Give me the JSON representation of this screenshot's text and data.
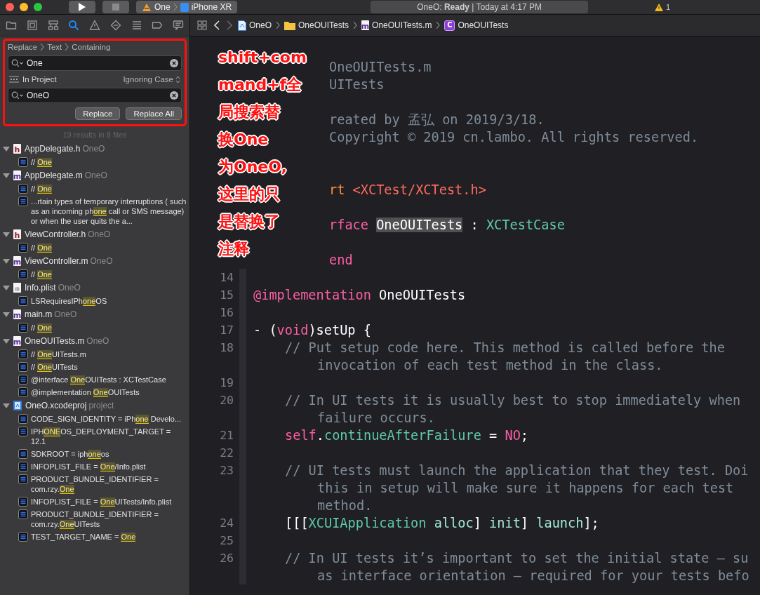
{
  "toolbar": {
    "target": "One",
    "device": "iPhone XR",
    "activity": "OneO: **Ready** | Today at 4:17 PM",
    "warning_count": "1"
  },
  "navigator_tabs": [
    {
      "kind": "folder",
      "selected": false
    },
    {
      "kind": "source-control",
      "selected": false
    },
    {
      "kind": "hierarchy",
      "selected": false
    },
    {
      "kind": "search",
      "selected": true
    },
    {
      "kind": "warning",
      "selected": false
    },
    {
      "kind": "diamond",
      "selected": false
    },
    {
      "kind": "list",
      "selected": false
    },
    {
      "kind": "tag",
      "selected": false
    },
    {
      "kind": "message",
      "selected": false
    }
  ],
  "jump_bar": [
    {
      "kind": "project",
      "label": "OneO"
    },
    {
      "kind": "folder",
      "label": "OneOUITests"
    },
    {
      "kind": "file",
      "badge": "m",
      "label": "OneOUITests.m"
    },
    {
      "kind": "class",
      "badge": "C",
      "label": "OneOUITests"
    }
  ],
  "find": {
    "path": [
      "Replace",
      "Text",
      "Containing"
    ],
    "query": "One",
    "scope": "In Project",
    "matching": "Ignoring Case",
    "replacement": "OneO",
    "buttons": [
      "Replace",
      "Replace All"
    ],
    "summary": "19 results in 8 files"
  },
  "results": [
    {
      "file": "AppDelegate.h",
      "project": "OneO",
      "kind": "source",
      "badge": "h",
      "expanded": true,
      "children": [
        {
          "parts": [
            {
              "text": "//  ",
              "match": false
            },
            {
              "text": "One",
              "match": true
            }
          ]
        }
      ]
    },
    {
      "file": "AppDelegate.m",
      "project": "OneO",
      "kind": "source",
      "badge": "m",
      "expanded": true,
      "children": [
        {
          "parts": [
            {
              "text": "//  ",
              "match": false
            },
            {
              "text": "One",
              "match": true
            }
          ]
        },
        {
          "parts": [
            {
              "text": "...rtain types of temporary interruptions ( such as an incoming ph",
              "match": false
            },
            {
              "text": "one",
              "match": true
            },
            {
              "text": " call or SMS message) or when the user quits the a...",
              "match": false
            }
          ]
        }
      ]
    },
    {
      "file": "ViewController.h",
      "project": "OneO",
      "kind": "source",
      "badge": "h",
      "expanded": true,
      "children": [
        {
          "parts": [
            {
              "text": "//  ",
              "match": false
            },
            {
              "text": "One",
              "match": true
            }
          ]
        }
      ]
    },
    {
      "file": "ViewController.m",
      "project": "OneO",
      "kind": "source",
      "badge": "m",
      "expanded": true,
      "children": [
        {
          "parts": [
            {
              "text": "//  ",
              "match": false
            },
            {
              "text": "One",
              "match": true
            }
          ]
        }
      ]
    },
    {
      "file": "Info.plist",
      "project": "OneO",
      "kind": "plist",
      "expanded": true,
      "children": [
        {
          "parts": [
            {
              "text": "LSRequiresIPh",
              "match": false
            },
            {
              "text": "one",
              "match": true
            },
            {
              "text": "OS",
              "match": false
            }
          ]
        }
      ]
    },
    {
      "file": "main.m",
      "project": "OneO",
      "kind": "source",
      "badge": "m",
      "expanded": true,
      "children": [
        {
          "parts": [
            {
              "text": "//  ",
              "match": false
            },
            {
              "text": "One",
              "match": true
            }
          ]
        }
      ]
    },
    {
      "file": "OneOUITests.m",
      "project": "OneO",
      "kind": "source",
      "badge": "m",
      "expanded": true,
      "children": [
        {
          "parts": [
            {
              "text": "//  ",
              "match": false
            },
            {
              "text": "One",
              "match": true
            },
            {
              "text": "UITests.m",
              "match": false
            }
          ]
        },
        {
          "parts": [
            {
              "text": "//  ",
              "match": false
            },
            {
              "text": "One",
              "match": true
            },
            {
              "text": "UITests",
              "match": false
            }
          ]
        },
        {
          "parts": [
            {
              "text": "@interface ",
              "match": false
            },
            {
              "text": "One",
              "match": true
            },
            {
              "text": "OUITests : XCTestCase",
              "match": false
            }
          ]
        },
        {
          "parts": [
            {
              "text": "@implementation ",
              "match": false
            },
            {
              "text": "One",
              "match": true
            },
            {
              "text": "OUITests",
              "match": false
            }
          ]
        }
      ]
    },
    {
      "file": "OneO.xcodeproj",
      "project": "project",
      "kind": "project",
      "expanded": true,
      "children": [
        {
          "parts": [
            {
              "text": "CODE_SIGN_IDENTITY = iPh",
              "match": false
            },
            {
              "text": "one",
              "match": true
            },
            {
              "text": " Develo...",
              "match": false
            }
          ]
        },
        {
          "parts": [
            {
              "text": "IPH",
              "match": false
            },
            {
              "text": "ONE",
              "match": true
            },
            {
              "text": "OS_DEPLOYMENT_TARGET = 12.1",
              "match": false
            }
          ]
        },
        {
          "parts": [
            {
              "text": "SDKROOT = iph",
              "match": false
            },
            {
              "text": "one",
              "match": true
            },
            {
              "text": "os",
              "match": false
            }
          ]
        },
        {
          "parts": [
            {
              "text": "INFOPLIST_FILE = ",
              "match": false
            },
            {
              "text": "One",
              "match": true
            },
            {
              "text": "/Info.plist",
              "match": false
            }
          ]
        },
        {
          "parts": [
            {
              "text": "PRODUCT_BUNDLE_IDENTIFIER = com.rzy.",
              "match": false
            },
            {
              "text": "One",
              "match": true
            }
          ]
        },
        {
          "parts": [
            {
              "text": "INFOPLIST_FILE = ",
              "match": false
            },
            {
              "text": "One",
              "match": true
            },
            {
              "text": "UITests/Info.plist",
              "match": false
            }
          ]
        },
        {
          "parts": [
            {
              "text": "PRODUCT_BUNDLE_IDENTIFIER = com.rzy.",
              "match": false
            },
            {
              "text": "One",
              "match": true
            },
            {
              "text": "UITests",
              "match": false
            }
          ]
        },
        {
          "parts": [
            {
              "text": "TEST_TARGET_NAME = ",
              "match": false
            },
            {
              "text": "One",
              "match": true
            }
          ]
        }
      ]
    }
  ],
  "annotation": {
    "lines": [
      "shift+com",
      "mand+f全",
      "局搜索替",
      "换One",
      "为OneO,",
      "这里的只",
      "是替换了",
      "注释"
    ]
  },
  "editor": {
    "covered_rows": [
      {
        "kind": "blank"
      },
      {
        "kind": "code",
        "tokens": [
          {
            "kind": "comment",
            "text": "OneOUITests.m"
          }
        ]
      },
      {
        "kind": "code",
        "tokens": [
          {
            "kind": "comment",
            "text": "UITests"
          }
        ]
      },
      {
        "kind": "blank"
      },
      {
        "kind": "code",
        "tokens": [
          {
            "kind": "comment",
            "text": "reated by 孟弘 on 2019/3/18."
          }
        ]
      },
      {
        "kind": "code",
        "tokens": [
          {
            "kind": "comment",
            "text": "Copyright © 2019 cn.lambo. All rights reserved."
          }
        ]
      },
      {
        "kind": "blank"
      },
      {
        "kind": "blank"
      },
      {
        "kind": "code",
        "tokens": [
          {
            "kind": "preprocessor",
            "text": "rt "
          },
          {
            "kind": "string",
            "text": "<XCTest/XCTest.h>"
          }
        ]
      },
      {
        "kind": "blank"
      },
      {
        "kind": "code",
        "tokens": [
          {
            "kind": "keyword",
            "text": "rface "
          },
          {
            "kind": "selected",
            "text": "OneOUITests"
          },
          {
            "kind": "plain",
            "text": " : "
          },
          {
            "kind": "class",
            "text": "XCTestCase"
          }
        ]
      },
      {
        "kind": "blank"
      },
      {
        "kind": "code",
        "tokens": [
          {
            "kind": "keyword",
            "text": "end"
          }
        ]
      }
    ],
    "rows": [
      {
        "kind": "blank",
        "number": "14"
      },
      {
        "kind": "top",
        "number": "15",
        "tokens": [
          {
            "kind": "keyword",
            "text": "@implementation"
          },
          {
            "kind": "plain",
            "text": " OneOUITests"
          }
        ]
      },
      {
        "kind": "blank",
        "number": "16"
      },
      {
        "kind": "top",
        "number": "17",
        "tokens": [
          {
            "kind": "plain",
            "text": "- ("
          },
          {
            "kind": "keyword",
            "text": "void"
          },
          {
            "kind": "plain",
            "text": ")setUp {"
          }
        ]
      },
      {
        "kind": "body",
        "number": "18",
        "tokens": [
          {
            "kind": "comment",
            "text": "// Put setup code here. This method is called before the"
          }
        ]
      },
      {
        "kind": "wrap",
        "tokens": [
          {
            "kind": "comment",
            "text": "invocation of each test method in the class."
          }
        ]
      },
      {
        "kind": "blank",
        "number": "19"
      },
      {
        "kind": "body",
        "number": "20",
        "tokens": [
          {
            "kind": "comment",
            "text": "// In UI tests it is usually best to stop immediately when"
          }
        ]
      },
      {
        "kind": "wrap",
        "tokens": [
          {
            "kind": "comment",
            "text": "failure occurs."
          }
        ]
      },
      {
        "kind": "body",
        "number": "21",
        "tokens": [
          {
            "kind": "keyword",
            "text": "self"
          },
          {
            "kind": "plain",
            "text": "."
          },
          {
            "kind": "class",
            "text": "continueAfterFailure"
          },
          {
            "kind": "plain",
            "text": " = "
          },
          {
            "kind": "keyword",
            "text": "NO"
          },
          {
            "kind": "plain",
            "text": ";"
          }
        ]
      },
      {
        "kind": "blank",
        "number": "22"
      },
      {
        "kind": "body",
        "number": "23",
        "tokens": [
          {
            "kind": "comment",
            "text": "// UI tests must launch the application that they test. Doi"
          }
        ]
      },
      {
        "kind": "wrap",
        "tokens": [
          {
            "kind": "comment",
            "text": "this in setup will make sure it happens for each test"
          }
        ]
      },
      {
        "kind": "wrap",
        "tokens": [
          {
            "kind": "comment",
            "text": "method."
          }
        ]
      },
      {
        "kind": "body",
        "number": "24",
        "tokens": [
          {
            "kind": "plain",
            "text": "[[["
          },
          {
            "kind": "class",
            "text": "XCUIApplication"
          },
          {
            "kind": "method",
            "text": " alloc"
          },
          {
            "kind": "plain",
            "text": "] "
          },
          {
            "kind": "method",
            "text": "init"
          },
          {
            "kind": "plain",
            "text": "] "
          },
          {
            "kind": "method",
            "text": "launch"
          },
          {
            "kind": "plain",
            "text": "];"
          }
        ]
      },
      {
        "kind": "blank",
        "number": "25"
      },
      {
        "kind": "body",
        "number": "26",
        "tokens": [
          {
            "kind": "comment",
            "text": "// In UI tests it’s important to set the initial state – su"
          }
        ]
      },
      {
        "kind": "wrap",
        "tokens": [
          {
            "kind": "comment",
            "text": "as interface orientation – required for your tests befo"
          }
        ]
      }
    ]
  }
}
